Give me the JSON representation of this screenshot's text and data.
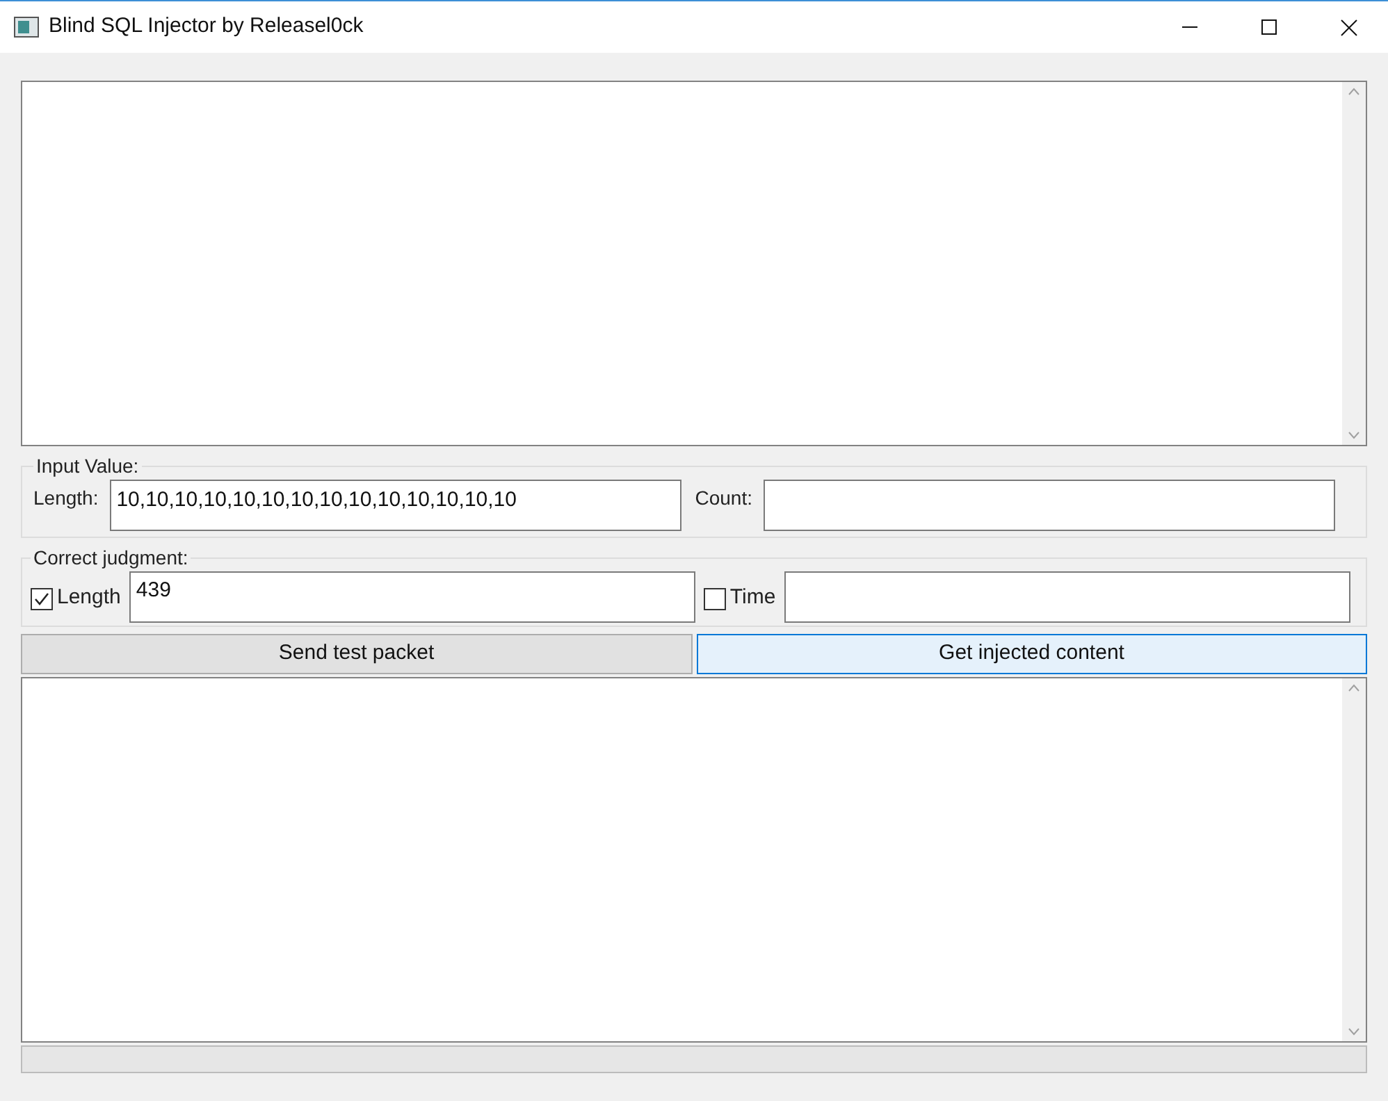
{
  "window": {
    "title": "Blind SQL Injector by Releasel0ck"
  },
  "input_value": {
    "legend": "Input Value:",
    "length_label": "Length:",
    "length_value": "10,10,10,10,10,10,10,10,10,10,10,10,10,10",
    "count_label": "Count:"
  },
  "correct_judgment": {
    "legend": "Correct judgment:",
    "length_checkbox": {
      "label": "Length",
      "checked": true
    },
    "length_value": "439",
    "time_checkbox": {
      "label": "Time",
      "checked": false
    }
  },
  "buttons": [
    {
      "label": "Send test packet",
      "hovered": false
    },
    {
      "label": "Get injected content",
      "hovered": true
    }
  ],
  "progress": {
    "level": 0
  }
}
